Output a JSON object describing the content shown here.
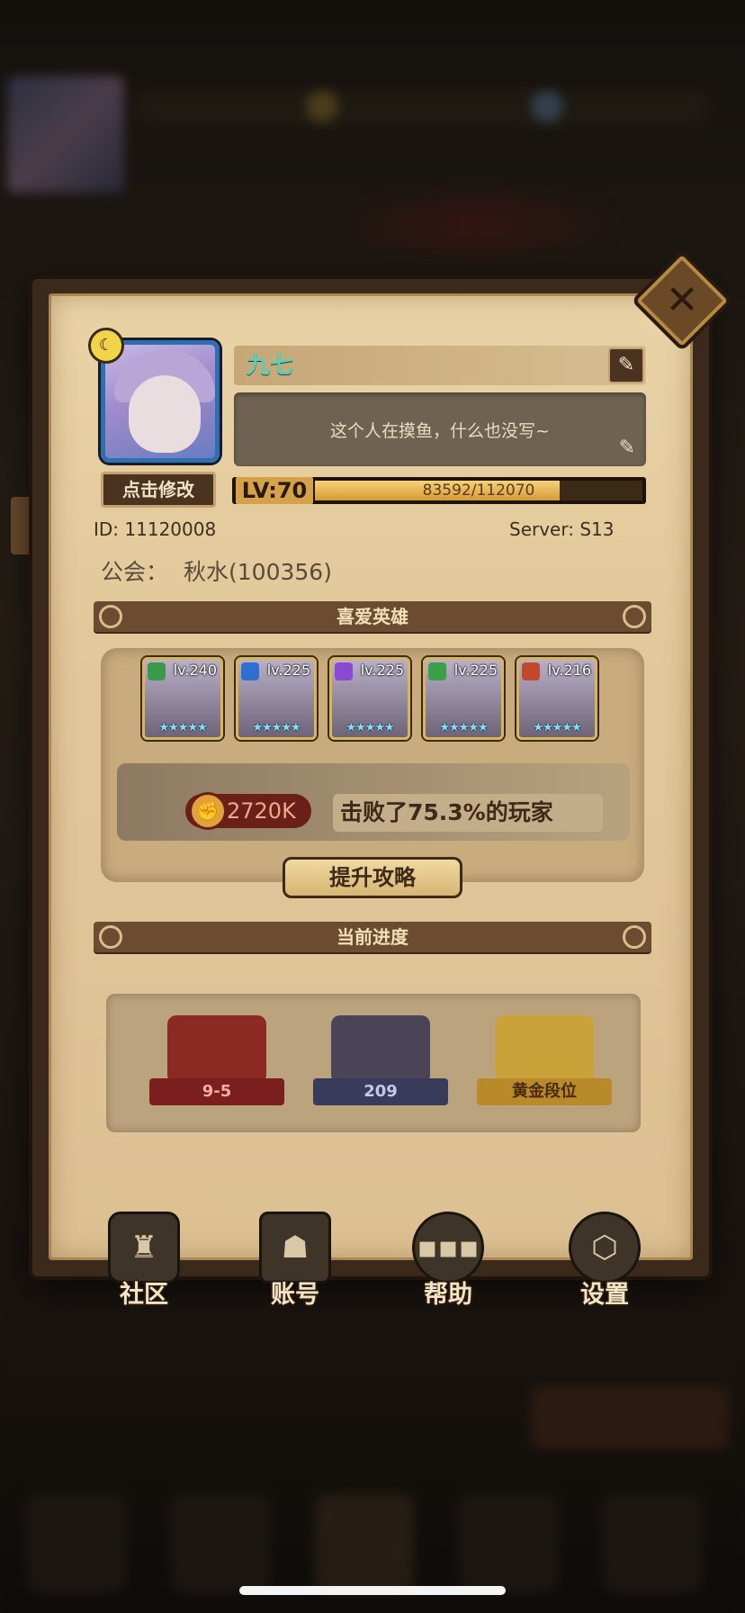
{
  "profile": {
    "name": "九七",
    "signature": "这个人在摸鱼，什么也没写~",
    "edit_avatar_label": "点击修改",
    "level_label": "LV:70",
    "xp_text": "83592/112070",
    "xp_fraction": 0.746,
    "id_text": "ID: 11120008",
    "server_text": "Server: S13",
    "guild_label": "公会：",
    "guild_value": "秋水(100356)"
  },
  "sections": {
    "favorite_heroes": "喜爱英雄",
    "current_progress": "当前进度"
  },
  "heroes": [
    {
      "level": "lv.240",
      "badge_color": "#3a9a4a",
      "stars": "★★★★★"
    },
    {
      "level": "lv.225",
      "badge_color": "#2e6fd0",
      "stars": "★★★★★"
    },
    {
      "level": "lv.225",
      "badge_color": "#8a4ad0",
      "stars": "★★★★★"
    },
    {
      "level": "lv.225",
      "badge_color": "#3aa04a",
      "stars": "★★★★★"
    },
    {
      "level": "lv.216",
      "badge_color": "#c04a2a",
      "stars": "★★★★★"
    }
  ],
  "power": {
    "value": "2720K",
    "defeat_text": "击败了75.3%的玩家",
    "strategy_button": "提升攻略"
  },
  "progress": [
    {
      "label": "9-5",
      "ribbon_color": "#7a1e1e",
      "text_color": "#f4b0a0",
      "emblem_color": "#8a2a22"
    },
    {
      "label": "209",
      "ribbon_color": "#3a3a5a",
      "text_color": "#c6c6ee",
      "emblem_color": "#4a4458"
    },
    {
      "label": "黄金段位",
      "ribbon_color": "#b88a2a",
      "text_color": "#4a2a0a",
      "emblem_color": "#c9a23a"
    }
  ],
  "bottom_nav": [
    {
      "label": "社区",
      "icon": "castle-icon"
    },
    {
      "label": "账号",
      "icon": "account-card-icon"
    },
    {
      "label": "帮助",
      "icon": "chat-bubble-icon"
    },
    {
      "label": "设置",
      "icon": "gear-icon"
    }
  ],
  "colors": {
    "name_color": "#5bd0b3",
    "xp_fill": "#d69a34",
    "panel_parchment": "#e1c79a"
  }
}
